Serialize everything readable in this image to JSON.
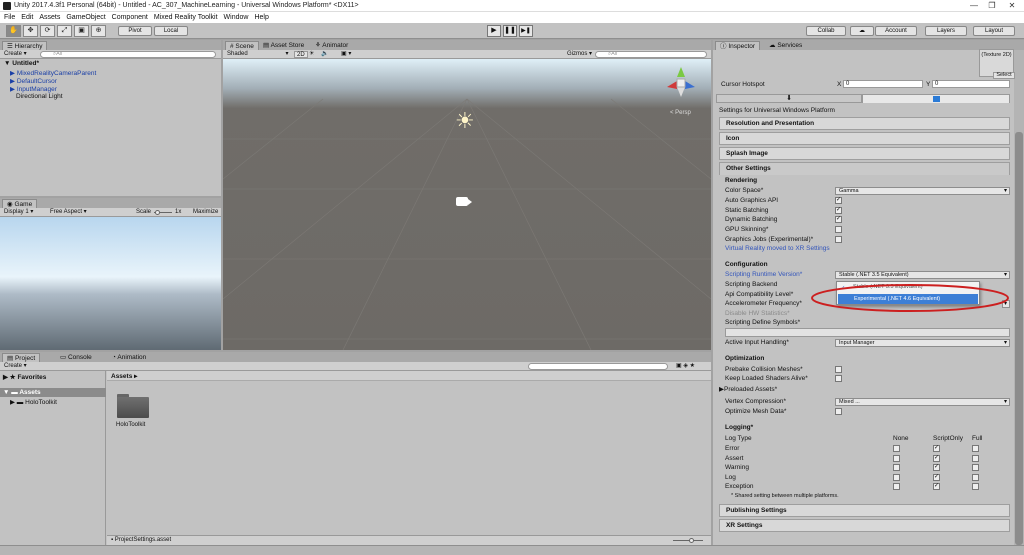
{
  "window": {
    "title": "Unity 2017.4.3f1 Personal (64bit) - Untitled - AC_307_MachineLearning - Universal Windows Platform* <DX11>",
    "minimize": "—",
    "maximize": "❐",
    "close": "✕"
  },
  "menu": [
    "File",
    "Edit",
    "Assets",
    "GameObject",
    "Component",
    "Mixed Reality Toolkit",
    "Window",
    "Help"
  ],
  "toolbar": {
    "tools": [
      "✋",
      "✥",
      "⟳",
      "⤢",
      "▣",
      "⊕"
    ],
    "pivot": "Pivot",
    "local": "Local",
    "play": "▶",
    "pause": "❚❚",
    "step": "▶❚",
    "collab": "Collab",
    "account": "Account",
    "layers": "Layers",
    "layout": "Layout"
  },
  "hierarchy": {
    "tab": "Hierarchy",
    "create": "Create",
    "search_placeholder": "⌕All",
    "scene": "Untitled*",
    "items": [
      {
        "label": "MixedRealityCameraParent",
        "blue": true,
        "arrow": "▶"
      },
      {
        "label": "DefaultCursor",
        "blue": true,
        "arrow": "▶"
      },
      {
        "label": "InputManager",
        "blue": true,
        "arrow": "▶"
      },
      {
        "label": "Directional Light",
        "blue": false,
        "arrow": ""
      }
    ]
  },
  "scene": {
    "tabs": [
      "Scene",
      "Asset Store",
      "Animator"
    ],
    "shaded": "Shaded",
    "mode2d": "2D",
    "gizmos": "Gizmos",
    "search_placeholder": "⌕All",
    "persp": "< Persp"
  },
  "game": {
    "tab": "Game",
    "display": "Display 1",
    "aspect": "Free Aspect",
    "scale_label": "Scale",
    "scale_value": "1x",
    "maximize": "Maximize"
  },
  "project": {
    "tabs": [
      "Project",
      "Console",
      "Animation"
    ],
    "create": "Create",
    "favorites": "Favorites",
    "assets": "Assets",
    "holotoolkit": "HoloToolkit",
    "breadcrumb": "Assets ▸",
    "folder_label": "HoloToolkit",
    "footer": "ProjectSettings.asset"
  },
  "inspector": {
    "tabs": [
      "Inspector",
      "Services"
    ],
    "texture_box": "(Texture 2D)",
    "select": "Select",
    "cursor_hotspot": "Cursor Hotspot",
    "x_label": "X",
    "x_value": "0",
    "y_label": "Y",
    "y_value": "0",
    "settings_for": "Settings for Universal Windows Platform",
    "sections_top": [
      "Resolution and Presentation",
      "Icon",
      "Splash Image"
    ],
    "other_settings": "Other Settings",
    "rendering": "Rendering",
    "color_space": "Color Space*",
    "color_space_value": "Gamma",
    "rendering_checks": [
      {
        "label": "Auto Graphics API",
        "checked": true
      },
      {
        "label": "Static Batching",
        "checked": true
      },
      {
        "label": "Dynamic Batching",
        "checked": true
      },
      {
        "label": "GPU Skinning*",
        "checked": false
      },
      {
        "label": "Graphics Jobs (Experimental)*",
        "checked": false
      }
    ],
    "vr_link": "Virtual Reality moved to XR Settings",
    "configuration": "Configuration",
    "scripting_runtime": "Scripting Runtime Version*",
    "scripting_runtime_value": "Stable (.NET 3.5 Equivalent)",
    "scripting_backend": "Scripting Backend",
    "api_compat": "Api Compatibility Level*",
    "accelerometer": "Accelerometer Frequency*",
    "disable_hw": "Disable HW Statistics*",
    "define_symbols": "Scripting Define Symbols*",
    "active_input": "Active Input Handling*",
    "active_input_value": "Input Manager",
    "dropdown_options": [
      "Stable (.NET 3.5 Equivalent)",
      "Experimental (.NET 4.6 Equivalent)"
    ],
    "optimization": "Optimization",
    "prebake": "Prebake Collision Meshes*",
    "keep_shaders": "Keep Loaded Shaders Alive*",
    "preloaded": "Preloaded Assets*",
    "vertex_compression": "Vertex Compression*",
    "vertex_compression_value": "Mixed ...",
    "optimize_mesh": "Optimize Mesh Data*",
    "logging": "Logging*",
    "log_type": "Log Type",
    "log_cols": [
      "None",
      "ScriptOnly",
      "Full"
    ],
    "log_rows": [
      {
        "label": "Error",
        "values": [
          false,
          true,
          false
        ]
      },
      {
        "label": "Assert",
        "values": [
          false,
          true,
          false
        ]
      },
      {
        "label": "Warning",
        "values": [
          false,
          true,
          false
        ]
      },
      {
        "label": "Log",
        "values": [
          false,
          true,
          false
        ]
      },
      {
        "label": "Exception",
        "values": [
          false,
          true,
          false
        ]
      }
    ],
    "shared_note": "* Shared setting between multiple platforms.",
    "publishing": "Publishing Settings",
    "xr": "XR Settings"
  },
  "colors": {
    "annotation": "#cc1f1f",
    "selection": "#3d7fd6",
    "link": "#3355bb"
  }
}
